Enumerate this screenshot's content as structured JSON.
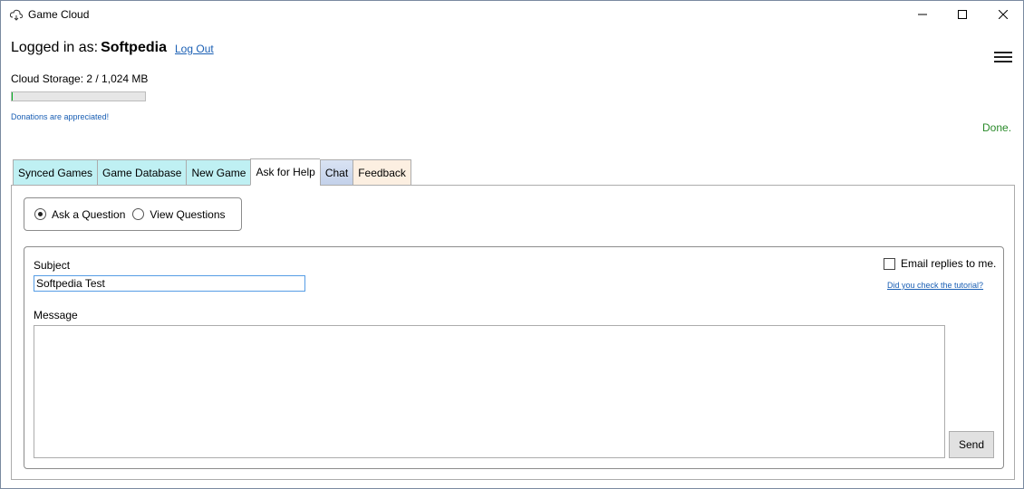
{
  "window": {
    "title": "Game Cloud",
    "icon": "cloud-game-icon",
    "controls": {
      "minimize": "minimize-icon",
      "maximize": "maximize-icon",
      "close": "close-icon"
    }
  },
  "header": {
    "logged_in_prefix": "Logged in as:",
    "username": "Softpedia",
    "logout_label": "Log Out",
    "menu_icon": "hamburger-menu-icon",
    "storage_label": "Cloud Storage: 2 / 1,024 MB",
    "storage_used_fraction": 0.002,
    "donations_label": "Donations are appreciated!",
    "status_text": "Done.",
    "status_color": "#2a8a2a"
  },
  "tabs": [
    {
      "label": "Synced Games",
      "active": false
    },
    {
      "label": "Game Database",
      "active": false
    },
    {
      "label": "New Game",
      "active": false
    },
    {
      "label": "Ask for Help",
      "active": true
    },
    {
      "label": "Chat",
      "active": false
    },
    {
      "label": "Feedback",
      "active": false
    }
  ],
  "help": {
    "modes": [
      {
        "label": "Ask a Question",
        "selected": true
      },
      {
        "label": "View Questions",
        "selected": false
      }
    ],
    "subject_label": "Subject",
    "subject_value": "Softpedia Test",
    "message_label": "Message",
    "message_value": "",
    "email_replies_label": "Email replies to me.",
    "email_replies_checked": false,
    "tutorial_link": "Did you check the tutorial?",
    "send_label": "Send"
  },
  "colors": {
    "link": "#1a5fb4",
    "tab_cyan": "#bff0f3",
    "tab_chat": "#c3d1ea",
    "tab_feedback": "#fcefe1"
  }
}
